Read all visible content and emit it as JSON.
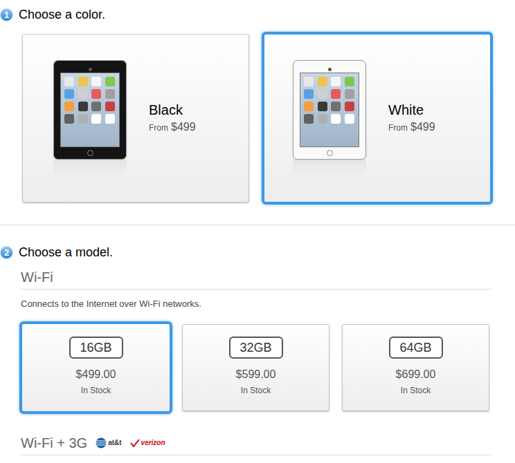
{
  "steps": [
    {
      "number": "1",
      "title": "Choose a color."
    },
    {
      "number": "2",
      "title": "Choose a model."
    }
  ],
  "colors": [
    {
      "name": "Black",
      "from_label": "From",
      "price": "$499",
      "selected": false,
      "color": "#141414"
    },
    {
      "name": "White",
      "from_label": "From",
      "price": "$499",
      "selected": true,
      "color": "#fafafa"
    }
  ],
  "model_sections": [
    {
      "title": "Wi-Fi",
      "description": "Connects to the Internet over Wi-Fi networks.",
      "carriers": [],
      "options": [
        {
          "capacity": "16GB",
          "price": "$499.00",
          "availability": "In Stock",
          "selected": true
        },
        {
          "capacity": "32GB",
          "price": "$599.00",
          "availability": "In Stock",
          "selected": false
        },
        {
          "capacity": "64GB",
          "price": "$699.00",
          "availability": "In Stock",
          "selected": false
        }
      ]
    },
    {
      "title": "Wi-Fi + 3G",
      "carriers": [
        {
          "name": "at&t",
          "kind": "globe",
          "color": "#1f5ea8"
        },
        {
          "name": "verizon",
          "kind": "check",
          "color": "#cd040b"
        }
      ],
      "options": []
    }
  ]
}
